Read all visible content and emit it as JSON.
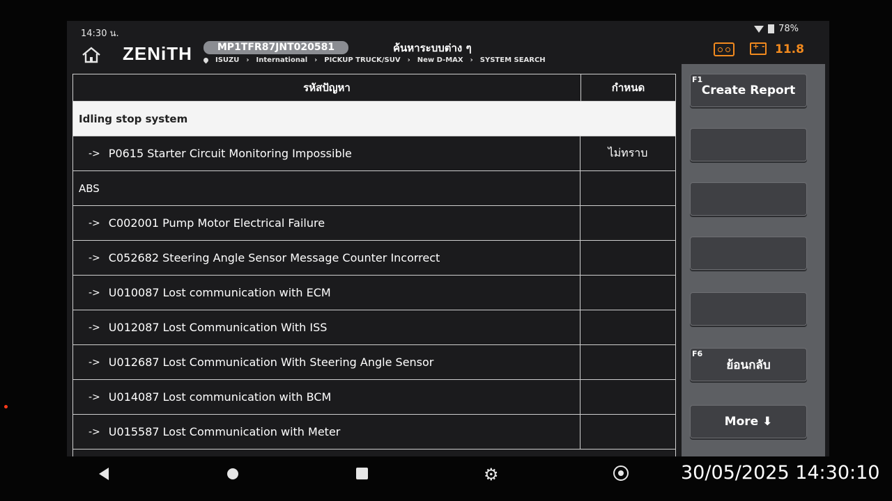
{
  "status": {
    "time": "14:30 น.",
    "battery": "78%"
  },
  "header": {
    "logo": "ZENiTH",
    "vin": "MP1TFR87JNT020581",
    "title": "ค้นหาระบบต่าง ๆ",
    "breadcrumb": [
      "ISUZU",
      "International",
      "PICKUP TRUCK/SUV",
      "New D-MAX",
      "SYSTEM SEARCH"
    ],
    "voltage": "11.8"
  },
  "table": {
    "headers": {
      "code": "รหัสปัญหา",
      "definition": "กำหนด"
    },
    "rows": [
      {
        "type": "group",
        "code": "Idling stop system",
        "definition": ""
      },
      {
        "type": "item",
        "code": "P0615 Starter Circuit Monitoring Impossible",
        "definition": "ไม่ทราบ"
      },
      {
        "type": "group",
        "code": "ABS",
        "definition": ""
      },
      {
        "type": "item",
        "code": "C002001 Pump Motor Electrical Failure",
        "definition": ""
      },
      {
        "type": "item",
        "code": "C052682 Steering Angle Sensor Message Counter Incorrect",
        "definition": ""
      },
      {
        "type": "item",
        "code": "U010087 Lost communication with ECM",
        "definition": ""
      },
      {
        "type": "item",
        "code": "U012087 Lost Communication With ISS",
        "definition": ""
      },
      {
        "type": "item",
        "code": "U012687 Lost Communication With Steering Angle Sensor",
        "definition": ""
      },
      {
        "type": "item",
        "code": "U014087 Lost communication with BCM",
        "definition": ""
      },
      {
        "type": "item",
        "code": "U015587 Lost Communication with Meter",
        "definition": ""
      }
    ],
    "arrow": "->"
  },
  "side": {
    "f1_key": "F1",
    "f1_label": "Create Report",
    "f6_key": "F6",
    "f6_label": "ย้อนกลับ",
    "more_label": "More ⬇"
  },
  "footer": {
    "timestamp": "30/05/2025 14:30:10"
  },
  "colors": {
    "accent": "#f28a1e",
    "panel": "#5d5f63",
    "button": "#3f4044"
  }
}
